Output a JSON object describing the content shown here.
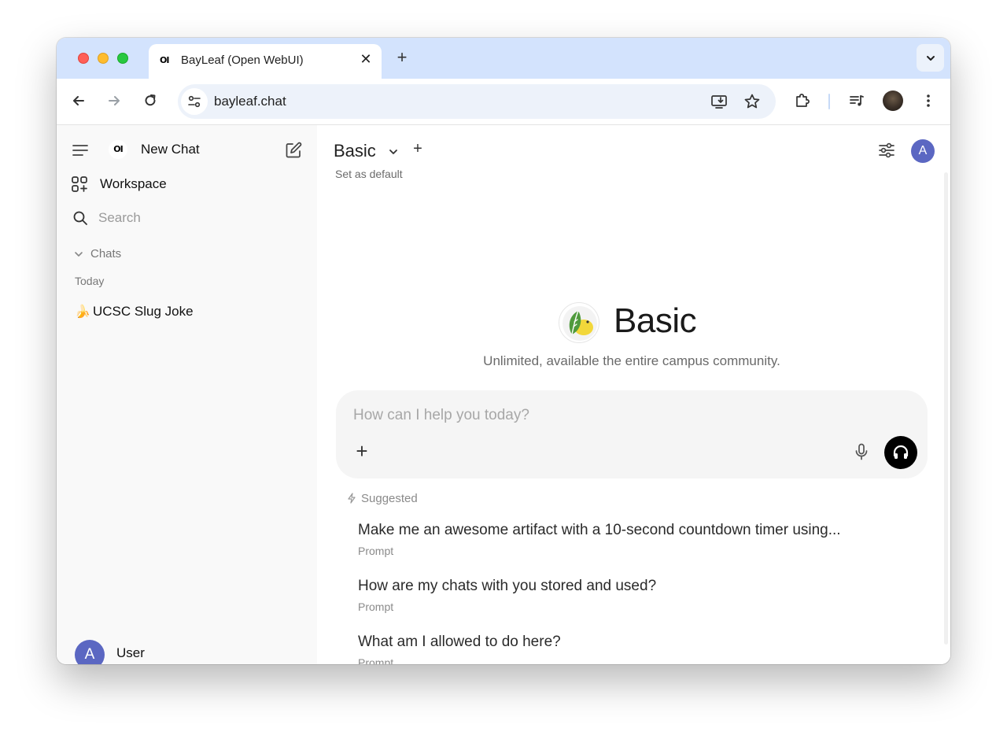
{
  "browser": {
    "tab_title": "BayLeaf (Open WebUI)",
    "tab_favicon_text": "OI",
    "close_glyph": "✕",
    "new_tab_glyph": "+",
    "url": "bayleaf.chat"
  },
  "sidebar": {
    "logo_text": "OI",
    "new_chat_label": "New Chat",
    "workspace_label": "Workspace",
    "search_placeholder": "Search",
    "chats_section_label": "Chats",
    "today_label": "Today",
    "chats": [
      {
        "emoji": "🍌",
        "title": "UCSC Slug Joke"
      }
    ],
    "user": {
      "avatar_letter": "A",
      "name": "User"
    }
  },
  "main": {
    "model_name": "Basic",
    "add_model_glyph": "+",
    "set_default_label": "Set as default",
    "user_avatar_letter": "A",
    "hero": {
      "title": "Basic",
      "subtitle": "Unlimited, available the entire campus community."
    },
    "composer": {
      "placeholder": "How can I help you today?",
      "plus_glyph": "+"
    },
    "suggested_label": "Suggested",
    "suggestions": [
      {
        "title": "Make me an awesome artifact with a 10-second countdown timer using...",
        "subtitle": "Prompt"
      },
      {
        "title": "How are my chats with you stored and used?",
        "subtitle": "Prompt"
      },
      {
        "title": "What am I allowed to do here?",
        "subtitle": "Prompt"
      }
    ]
  },
  "colors": {
    "tabstrip_bg": "#d3e3fd",
    "sidebar_bg": "#f9f9f9",
    "avatar_bg": "#5b67c2",
    "composer_bg": "#f5f5f5",
    "voice_button_bg": "#000000"
  }
}
